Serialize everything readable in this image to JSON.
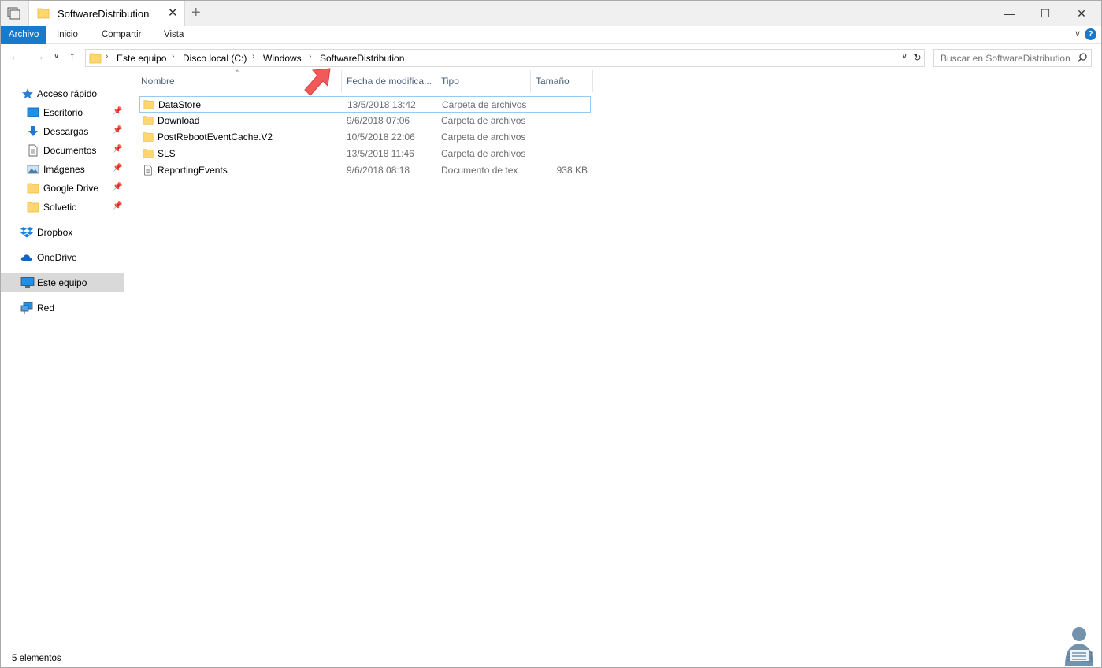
{
  "window": {
    "tab_title": "SoftwareDistribution",
    "tab_close": "✕",
    "new_tab": "+",
    "minimize": "—",
    "maximize": "☐",
    "close": "✕"
  },
  "ribbon": {
    "tabs": [
      "Archivo",
      "Inicio",
      "Compartir",
      "Vista"
    ],
    "expand": "∨",
    "help": "?"
  },
  "nav": {
    "back": "←",
    "forward": "→",
    "recent": "∨",
    "up": "↑",
    "breadcrumb": [
      "Este equipo",
      "Disco local (C:)",
      "Windows",
      "SoftwareDistribution"
    ],
    "separator": "›",
    "refresh": "↻",
    "search_placeholder": "Buscar en SoftwareDistribution"
  },
  "sidebar": {
    "quick_access": "Acceso rápido",
    "pinned": [
      {
        "label": "Escritorio",
        "icon": "desktop-icon"
      },
      {
        "label": "Descargas",
        "icon": "download-icon"
      },
      {
        "label": "Documentos",
        "icon": "documents-icon"
      },
      {
        "label": "Imágenes",
        "icon": "pictures-icon"
      },
      {
        "label": "Google Drive",
        "icon": "folder-icon"
      },
      {
        "label": "Solvetic",
        "icon": "folder-icon"
      }
    ],
    "dropbox": "Dropbox",
    "onedrive": "OneDrive",
    "this_pc": "Este equipo",
    "network": "Red"
  },
  "columns": [
    "Nombre",
    "Fecha de modifica...",
    "Tipo",
    "Tamaño"
  ],
  "files": [
    {
      "name": "DataStore",
      "date": "13/5/2018 13:42",
      "type": "Carpeta de archivos",
      "size": "",
      "kind": "folder"
    },
    {
      "name": "Download",
      "date": "9/6/2018 07:06",
      "type": "Carpeta de archivos",
      "size": "",
      "kind": "folder"
    },
    {
      "name": "PostRebootEventCache.V2",
      "date": "10/5/2018 22:06",
      "type": "Carpeta de archivos",
      "size": "",
      "kind": "folder"
    },
    {
      "name": "SLS",
      "date": "13/5/2018 11:46",
      "type": "Carpeta de archivos",
      "size": "",
      "kind": "folder"
    },
    {
      "name": "ReportingEvents",
      "date": "9/6/2018 08:18",
      "type": "Documento de tex",
      "size": "938 KB",
      "kind": "text"
    }
  ],
  "status": {
    "count": "5 elementos"
  },
  "colors": {
    "accent": "#1979ca",
    "folder": "#ffd76e",
    "arrow": "#f15a5a",
    "selected": "#d9d9d9"
  }
}
